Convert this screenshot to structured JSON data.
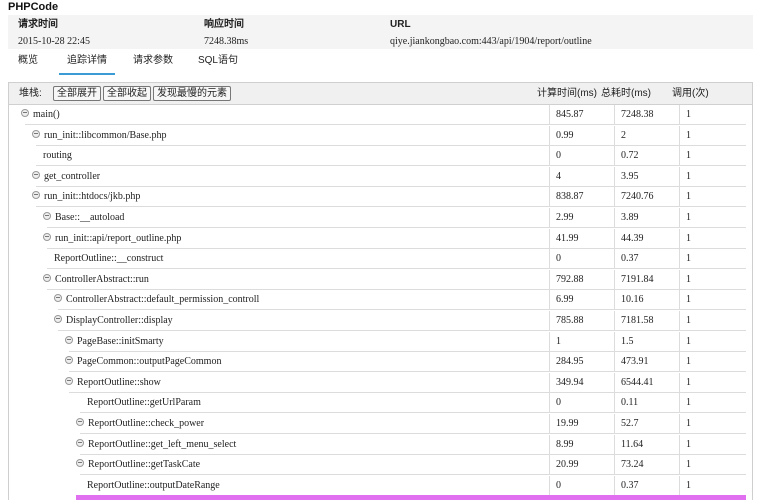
{
  "app_title": "PHPCode",
  "info": {
    "request_time_label": "请求时间",
    "request_time_value": "2015-10-28 22:45",
    "response_time_label": "响应时间",
    "response_time_value": "7248.38ms",
    "url_label": "URL",
    "url_value": "qiye.jiankongbao.com:443/api/1904/report/outline"
  },
  "tabs": [
    {
      "label": "概览"
    },
    {
      "label": "追踪详情"
    },
    {
      "label": "请求参数"
    },
    {
      "label": "SQL语句"
    }
  ],
  "toolbar": {
    "stack_label": "堆栈:",
    "expand_all": "全部展开",
    "collapse_all": "全部收起",
    "find_slowest": "发现最慢的元素",
    "col_calc_time": "计算时间(ms)",
    "col_total_time": "总耗时(ms)",
    "col_calls": "调用(次)"
  },
  "rows": [
    {
      "name": "main()",
      "calc": "845.87",
      "total": "7248.38",
      "calls": "1"
    },
    {
      "name": "run_init::libcommon/Base.php",
      "calc": "0.99",
      "total": "2",
      "calls": "1"
    },
    {
      "name": "routing",
      "calc": "0",
      "total": "0.72",
      "calls": "1"
    },
    {
      "name": "get_controller",
      "calc": "4",
      "total": "3.95",
      "calls": "1"
    },
    {
      "name": "run_init::htdocs/jkb.php",
      "calc": "838.87",
      "total": "7240.76",
      "calls": "1"
    },
    {
      "name": "Base::__autoload",
      "calc": "2.99",
      "total": "3.89",
      "calls": "1"
    },
    {
      "name": "run_init::api/report_outline.php",
      "calc": "41.99",
      "total": "44.39",
      "calls": "1"
    },
    {
      "name": "ReportOutline::__construct",
      "calc": "0",
      "total": "0.37",
      "calls": "1"
    },
    {
      "name": "ControllerAbstract::run",
      "calc": "792.88",
      "total": "7191.84",
      "calls": "1"
    },
    {
      "name": "ControllerAbstract::default_permission_controll",
      "calc": "6.99",
      "total": "10.16",
      "calls": "1"
    },
    {
      "name": "DisplayController::display",
      "calc": "785.88",
      "total": "7181.58",
      "calls": "1"
    },
    {
      "name": "PageBase::initSmarty",
      "calc": "1",
      "total": "1.5",
      "calls": "1"
    },
    {
      "name": "PageCommon::outputPageCommon",
      "calc": "284.95",
      "total": "473.91",
      "calls": "1"
    },
    {
      "name": "ReportOutline::show",
      "calc": "349.94",
      "total": "6544.41",
      "calls": "1"
    },
    {
      "name": "ReportOutline::getUrlParam",
      "calc": "0",
      "total": "0.11",
      "calls": "1"
    },
    {
      "name": "ReportOutline::check_power",
      "calc": "19.99",
      "total": "52.7",
      "calls": "1"
    },
    {
      "name": "ReportOutline::get_left_menu_select",
      "calc": "8.99",
      "total": "11.64",
      "calls": "1"
    },
    {
      "name": "ReportOutline::getTaskCate",
      "calc": "20.99",
      "total": "73.24",
      "calls": "1"
    },
    {
      "name": "ReportOutline::outputDateRange",
      "calc": "0",
      "total": "0.37",
      "calls": "1"
    }
  ],
  "colors": {
    "tab_active": "#3a9bd5",
    "slowest_highlight": "#e070f0"
  }
}
